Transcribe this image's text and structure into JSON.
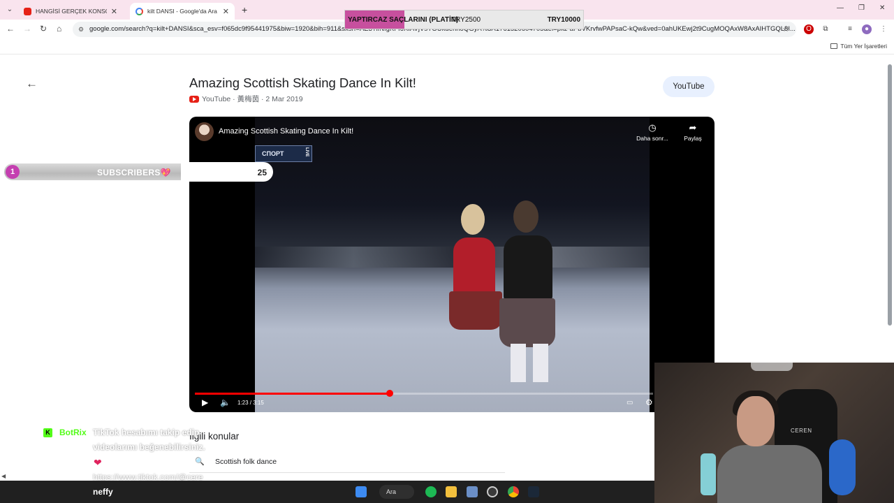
{
  "browser": {
    "tabs": [
      {
        "title": "HANGİSİ GERÇEK KONSOMATRİS",
        "active": false,
        "icon": "youtube-favicon"
      },
      {
        "title": "kilt DANSI - Google'da Ara",
        "active": true,
        "icon": "google-favicon"
      }
    ],
    "address": "google.com/search?q=kilt+DANSI&sca_esv=f065dc9f95441975&biw=1920&bih=911&sxsrf=AE3TifNIgKFI6XIAVjVsYOUkdehhoQGyA%3A1761520604705&ei=pkz-aPbVKrvfwPAPsaC-kQw&ved=0ahUKEwj2t9CugMOQAxW8AxAIHTGQL8I...",
    "bookmarks_all": "Tüm Yer İşaretleri"
  },
  "donation_goal": {
    "name": "YAPTIRCAZ SAÇLARINI (PLATİN)",
    "current": "TRY2500",
    "target": "TRY10000",
    "progress": 0.25,
    "color": "#c7509e"
  },
  "result": {
    "title": "Amazing Scottish Skating Dance In Kilt!",
    "meta": "YouTube · 黃梅茵 · 2 Mar 2019",
    "source_button": "YouTube"
  },
  "player": {
    "title": "Amazing Scottish Skating Dance In Kilt!",
    "watch_later": "Daha sonr...",
    "share": "Paylaş",
    "time": "1:23 / 3:15",
    "progress": 0.4256,
    "tv_badge": "СПОРТ",
    "tv_live": "LIVE"
  },
  "subscribers": {
    "goal_number": "1",
    "label": "SUBSCRIBERS",
    "emoji": "💖",
    "count": "25"
  },
  "chat": {
    "platform": "K",
    "user": "BotRix",
    "line1": "TikTok hesabımı takip edip",
    "line2": "videolarımı beğenebilirsiniz.",
    "heart": "❤",
    "url": "https://www.tiktok.com/@cere"
  },
  "related": {
    "title": "İlgili konular",
    "items": [
      "Scottish folk dance"
    ]
  },
  "webcam": {
    "chair_brand": "CEREN"
  },
  "taskbar": {
    "streamer": "neffy",
    "search": "Ara"
  },
  "colors": {
    "accent_red": "#ff0000",
    "youtube_red": "#e62117",
    "kick_green": "#53fc18",
    "subs_badge": "#c43fb0"
  }
}
